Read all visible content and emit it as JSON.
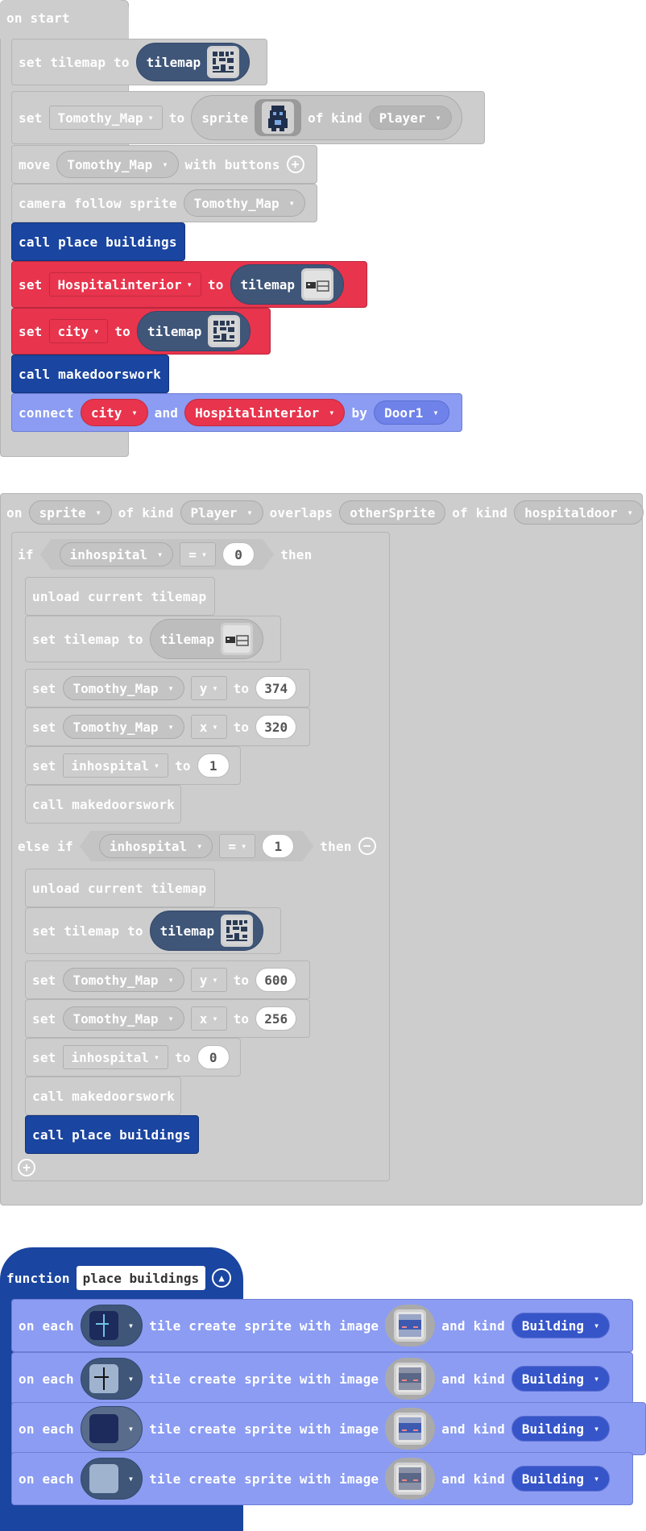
{
  "on_start": {
    "hat": "on start",
    "set_tilemap": {
      "kw": "set tilemap to",
      "pill": "tilemap"
    },
    "set_sprite": {
      "set": "set",
      "var": "Tomothy_Map",
      "to": "to",
      "sprite": "sprite",
      "of_kind": "of kind",
      "kind": "Player"
    },
    "move": {
      "kw": "move",
      "var": "Tomothy_Map",
      "with": "with buttons"
    },
    "camera": {
      "kw": "camera follow sprite",
      "var": "Tomothy_Map"
    },
    "call1": "call place buildings",
    "set_hosp": {
      "set": "set",
      "var": "Hospitalinterior",
      "to": "to",
      "pill": "tilemap"
    },
    "set_city": {
      "set": "set",
      "var": "city",
      "to": "to",
      "pill": "tilemap"
    },
    "call2": "call makedoorswork",
    "connect": {
      "kw": "connect",
      "a": "city",
      "and": "and",
      "b": "Hospitalinterior",
      "by": "by",
      "door": "Door1"
    }
  },
  "overlap": {
    "on": "on",
    "sprite": "sprite",
    "of_kind": "of kind",
    "kind": "Player",
    "overlaps": "overlaps",
    "other": "otherSprite",
    "of_kind2": "of kind",
    "kind2": "hospitaldoor",
    "if_kw": "if",
    "cond_var": "inhospital",
    "op": "=",
    "val0": "0",
    "then": "then",
    "unload": "unload current tilemap",
    "set_tilemap_kw": "set tilemap to",
    "tilemap": "tilemap",
    "set": "set",
    "tm": "Tomothy_Map",
    "y": "y",
    "x": "x",
    "to": "to",
    "v374": "374",
    "v320": "320",
    "inhospital": "inhospital",
    "v1": "1",
    "call_doors": "call makedoorswork",
    "else_if": "else if",
    "val1": "1",
    "v600": "600",
    "v256": "256",
    "v0b": "0",
    "call_place": "call place buildings"
  },
  "function": {
    "kw": "function",
    "name": "place buildings",
    "rows": [
      {
        "on_each": "on each",
        "create": "tile create sprite with image",
        "and_kind": "and kind",
        "kind": "Building"
      },
      {
        "on_each": "on each",
        "create": "tile create sprite with image",
        "and_kind": "and kind",
        "kind": "Building"
      },
      {
        "on_each": "on each",
        "create": "tile create sprite with image",
        "and_kind": "and kind",
        "kind": "Building"
      },
      {
        "on_each": "on each",
        "create": "tile create sprite with image",
        "and_kind": "and kind",
        "kind": "Building"
      }
    ]
  },
  "colors": {
    "events_gray": "#cdcdcd",
    "variables_red": "#e8344d",
    "functions_blue": "#1a45a0",
    "scene_blue": "#8b9cf2"
  },
  "icons": [
    "tilemap-thumbnail-icon",
    "sprite-thumbnail-icon",
    "add-icon",
    "remove-icon",
    "collapse-icon"
  ]
}
